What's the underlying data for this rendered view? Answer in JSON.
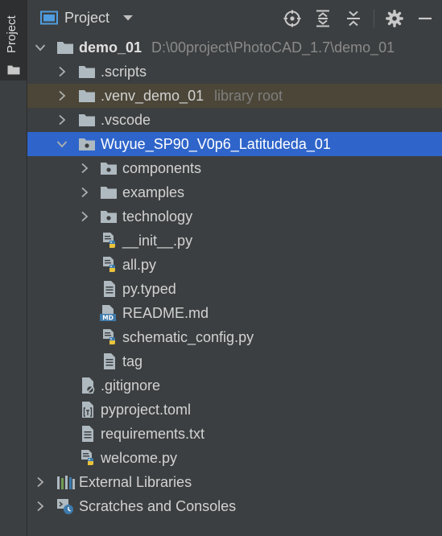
{
  "sidebar": {
    "tab_label": "Project"
  },
  "toolbar": {
    "title": "Project",
    "actions": [
      "locate-icon",
      "expand-all-icon",
      "collapse-all-icon",
      "gear-icon",
      "minimize-icon"
    ]
  },
  "tree": {
    "root": {
      "label": "demo_01",
      "path": "D:\\00project\\PhotoCAD_1.7\\demo_01"
    },
    "scripts": ".scripts",
    "venv": {
      "label": ".venv_demo_01",
      "note": "library root"
    },
    "vscode": ".vscode",
    "package": "Wuyue_SP90_V0p6_Latitudeda_01",
    "components": "components",
    "examples": "examples",
    "technology": "technology",
    "init": "__init__.py",
    "all": "all.py",
    "typed": "py.typed",
    "readme": "README.md",
    "schematic": "schematic_config.py",
    "tag": "tag",
    "gitignore": ".gitignore",
    "pyproject": "pyproject.toml",
    "requirements": "requirements.txt",
    "welcome": "welcome.py",
    "external": "External Libraries",
    "scratches": "Scratches and Consoles"
  },
  "colors": {
    "panel_bg": "#3c3f41",
    "selection": "#2f65ca",
    "library_root_highlight": "#4b4637",
    "folder_icon": "#aeb9c0"
  }
}
